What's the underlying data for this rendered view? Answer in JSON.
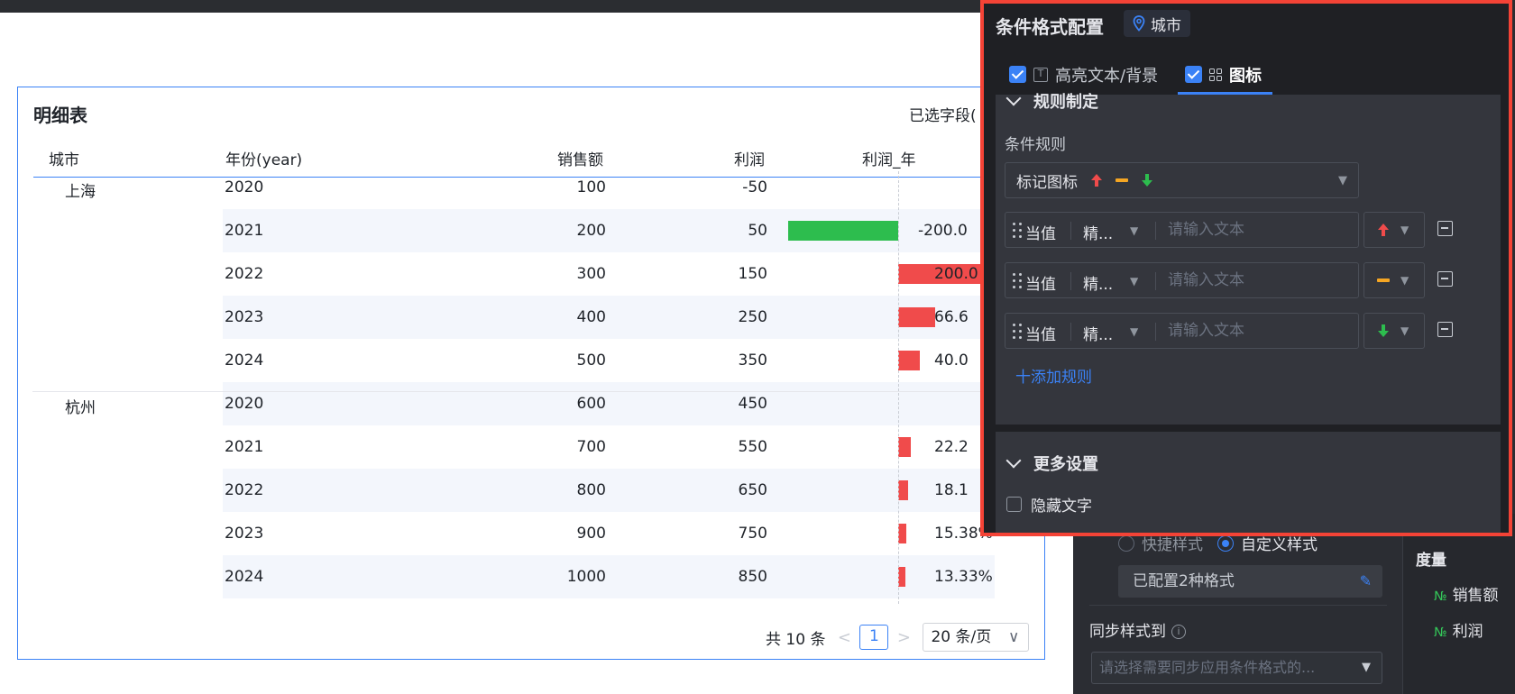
{
  "table": {
    "title": "明细表",
    "selected_fields": "已选字段(",
    "headers": {
      "city": "城市",
      "year": "年份(year)",
      "sales": "销售额",
      "profit": "利润",
      "profit_yoy": "利润_年"
    },
    "rows": [
      {
        "city": "上海",
        "year": "2020",
        "sales": "100",
        "profit": "-50",
        "pct": "",
        "bar": null
      },
      {
        "city": "",
        "year": "2021",
        "sales": "200",
        "profit": "50",
        "pct": "-200.0",
        "bar": {
          "value": -200,
          "color": "#2dbd4e"
        }
      },
      {
        "city": "",
        "year": "2022",
        "sales": "300",
        "profit": "150",
        "pct": "200.0",
        "bar": {
          "value": 200,
          "color": "#f04b4b"
        }
      },
      {
        "city": "",
        "year": "2023",
        "sales": "400",
        "profit": "250",
        "pct": "66.6",
        "bar": {
          "value": 66.67,
          "color": "#f04b4b"
        }
      },
      {
        "city": "",
        "year": "2024",
        "sales": "500",
        "profit": "350",
        "pct": "40.0",
        "bar": {
          "value": 40.0,
          "color": "#f04b4b"
        }
      },
      {
        "city": "杭州",
        "year": "2020",
        "sales": "600",
        "profit": "450",
        "pct": "",
        "bar": null
      },
      {
        "city": "",
        "year": "2021",
        "sales": "700",
        "profit": "550",
        "pct": "22.2",
        "bar": {
          "value": 22.22,
          "color": "#f04b4b"
        }
      },
      {
        "city": "",
        "year": "2022",
        "sales": "800",
        "profit": "650",
        "pct": "18.1",
        "bar": {
          "value": 18.18,
          "color": "#f04b4b"
        }
      },
      {
        "city": "",
        "year": "2023",
        "sales": "900",
        "profit": "750",
        "pct": "15.38%",
        "bar": {
          "value": 15.38,
          "color": "#f04b4b"
        }
      },
      {
        "city": "",
        "year": "2024",
        "sales": "1000",
        "profit": "850",
        "pct": "13.33%",
        "bar": {
          "value": 13.33,
          "color": "#f04b4b"
        }
      }
    ],
    "pagination": {
      "total": "共 10 条",
      "prev": "<",
      "current": "1",
      "next": ">",
      "page_size": "20 条/页"
    }
  },
  "popup": {
    "title": "条件格式配置",
    "field_tag": "城市",
    "tabs": [
      {
        "label": "高亮文本/背景",
        "checked": true
      },
      {
        "label": "图标",
        "checked": true,
        "active": true
      }
    ],
    "rules_section": {
      "title": "规则制定",
      "condition_label": "条件规则",
      "icon_set_label": "标记图标",
      "rules": [
        {
          "field": "当值",
          "operator": "精...",
          "placeholder": "请输入文本",
          "icon": "red-up-arrow"
        },
        {
          "field": "当值",
          "operator": "精...",
          "placeholder": "请输入文本",
          "icon": "orange-dash"
        },
        {
          "field": "当值",
          "operator": "精...",
          "placeholder": "请输入文本",
          "icon": "green-down-arrow"
        }
      ],
      "add_rule": "十添加规则"
    },
    "more_section": {
      "title": "更多设置",
      "hide_text": "隐藏文字"
    }
  },
  "side_panel": {
    "style_quick": "快捷样式",
    "style_custom": "自定义样式",
    "configured": "已配置2种格式",
    "sync_label": "同步样式到",
    "sync_placeholder": "请选择需要同步应用条件格式的...",
    "measure_title": "度量",
    "measures": [
      "销售额",
      "利润"
    ]
  },
  "colors": {
    "accent": "#3b82f6",
    "highlight_border": "#f44336",
    "up": "#f04b4b",
    "neutral": "#f5a623",
    "down": "#2dbd4e"
  }
}
